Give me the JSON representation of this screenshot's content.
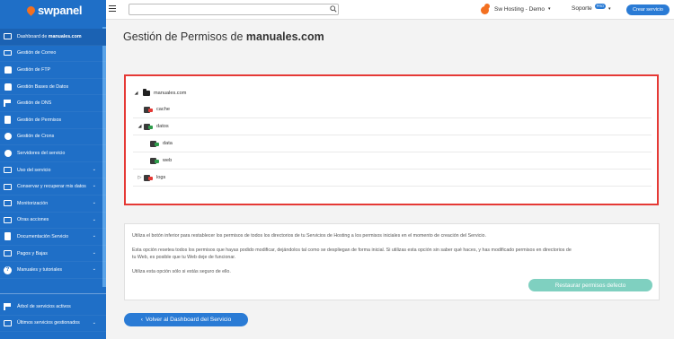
{
  "brand": {
    "name": "swpanel",
    "accent": "#f37021",
    "primary": "#1f6fc7"
  },
  "sidebar": {
    "items": [
      {
        "label": "Dashboard de ",
        "bold": "manuales.com",
        "icon": "dashboard-icon"
      },
      {
        "label": "Gestión de Correo",
        "icon": "mail-icon"
      },
      {
        "label": "Gestión de FTP",
        "icon": "database-icon"
      },
      {
        "label": "Gestión Bases de Datos",
        "icon": "database-icon"
      },
      {
        "label": "Gestión de DNS",
        "icon": "flag-icon"
      },
      {
        "label": "Gestión de Permisos",
        "icon": "permissions-icon"
      },
      {
        "label": "Gestión de Crons",
        "icon": "cron-icon"
      },
      {
        "label": "Servidores del servicio",
        "icon": "server-icon"
      },
      {
        "label": "Uso del servicio",
        "icon": "usage-icon"
      },
      {
        "label": "Conservar y recuperar mis datos",
        "icon": "backup-icon"
      },
      {
        "label": "Monitorización",
        "icon": "monitor-icon"
      },
      {
        "label": "Otras acciones",
        "icon": "actions-icon"
      },
      {
        "label": "Documentación Servicio",
        "icon": "document-icon"
      },
      {
        "label": "Pagos y Bajas",
        "icon": "payments-icon"
      },
      {
        "label": "Manuales y tutoriales",
        "icon": "help-icon"
      }
    ],
    "bottom": [
      {
        "label": "Árbol de servicios activos",
        "icon": "tree-icon"
      },
      {
        "label": "Últimos servicios gestionados",
        "icon": "history-icon"
      }
    ]
  },
  "topbar": {
    "search_value": "",
    "account_label": "Sw Hosting - Demo",
    "support_label": "Soporte",
    "support_badge": "PRO",
    "create_label": "Crear servicio"
  },
  "page": {
    "title_prefix": "Gestión de Permisos de ",
    "title_domain": "manuales.com"
  },
  "tree": {
    "root": "manuales.com",
    "nodes": [
      {
        "name": "cache",
        "status": "red",
        "indent": 1,
        "toggle": ""
      },
      {
        "name": "datos",
        "status": "green",
        "indent": 1,
        "toggle": "◢"
      },
      {
        "name": "data",
        "status": "green",
        "indent": 2,
        "toggle": ""
      },
      {
        "name": "web",
        "status": "green",
        "indent": 2,
        "toggle": ""
      },
      {
        "name": "logs",
        "status": "red",
        "indent": 1,
        "toggle": "▷"
      }
    ]
  },
  "info": {
    "p1": "Utiliza el botón inferior para restablecer los permisos de todos los directorios de tu Servicios de Hosting a los permisos iniciales en el momento de creación del Servicio.",
    "p2a": "Esta opción resetea todos los permisos que hayas podido modificar, dejándolos tal como se despliegan de forma inicial. Si utilizas esta opción sin saber qué haces, y has modificado permisos en directorios de",
    "p2b": "tu Web, es posible que tu Web deje de funcionar.",
    "p3": "Utiliza esta opción sólo si estás seguro de ello.",
    "restore_label": "Restaurar permisos defecto"
  },
  "back_label": "Volver al Dashboard del Servicio",
  "back_arrow": "‹"
}
